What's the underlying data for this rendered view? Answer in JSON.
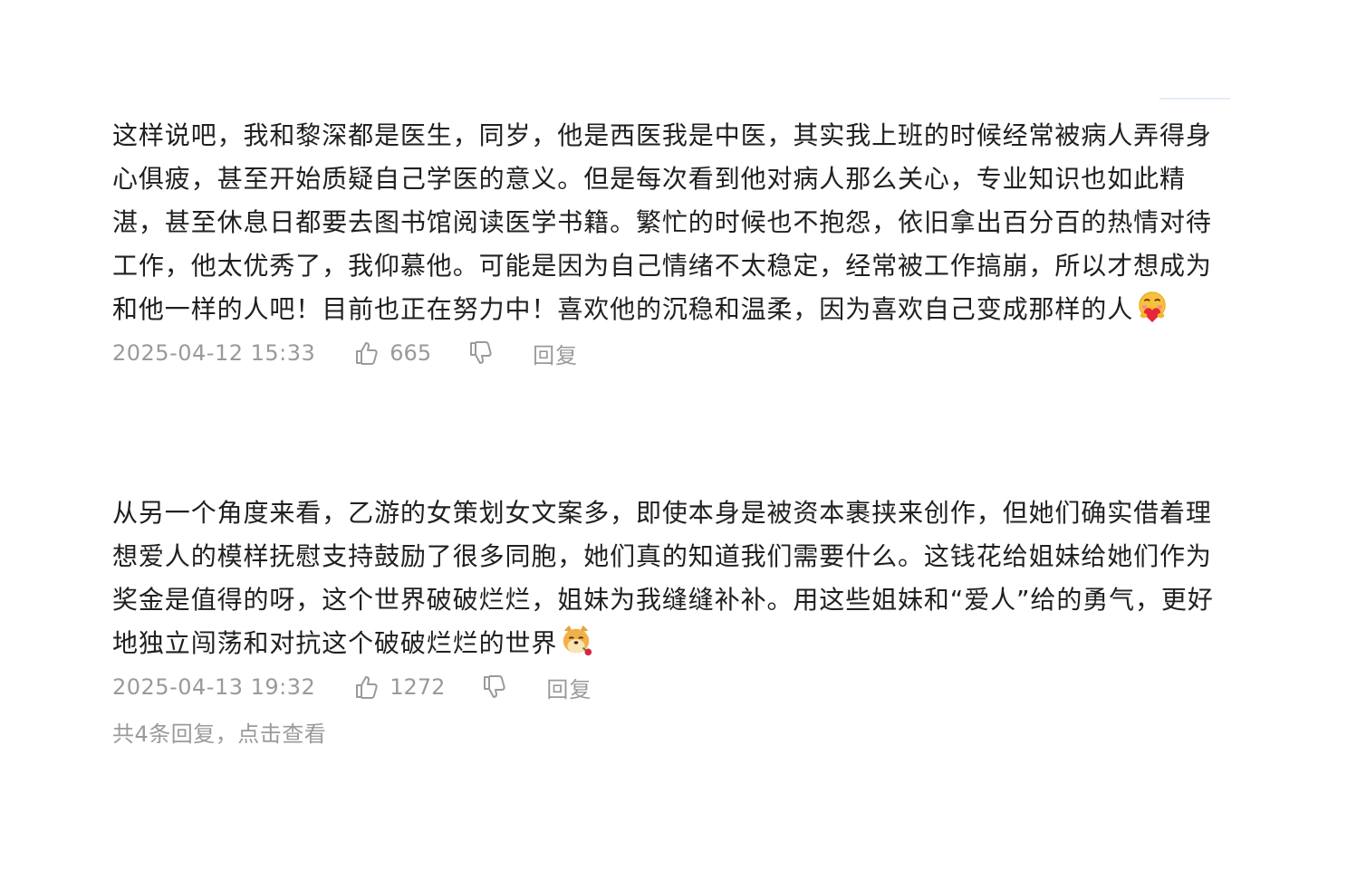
{
  "comments": [
    {
      "text": "这样说吧，我和黎深都是医生，同岁，他是西医我是中医，其实我上班的时候经常被病人弄得身心俱疲，甚至开始质疑自己学医的意义。但是每次看到他对病人那么关心，专业知识也如此精湛，甚至休息日都要去图书馆阅读医学书籍。繁忙的时候也不抱怨，依旧拿出百分百的热情对待工作，他太优秀了，我仰慕他。可能是因为自己情绪不太稳定，经常被工作搞崩，所以才想成为和他一样的人吧！目前也正在努力中！喜欢他的沉稳和温柔，因为喜欢自己变成那样的人",
      "emoji": "hugging-heart-emoji",
      "date": "2025-04-12 15:33",
      "likes": "665",
      "reply_label": "回复"
    },
    {
      "text": "从另一个角度来看，乙游的女策划女文案多，即使本身是被资本裹挟来创作，但她们确实借着理想爱人的模样抚慰支持鼓励了很多同胞，她们真的知道我们需要什么。这钱花给姐妹给她们作为奖金是值得的呀，这个世界破破烂烂，姐妹为我缝缝补补。用这些姐妹和“爱人”给的勇气，更好地独立闯荡和对抗这个破破烂烂的世界",
      "emoji": "doge-rose-emoji",
      "date": "2025-04-13 19:32",
      "likes": "1272",
      "reply_label": "回复",
      "replies_summary": "共4条回复，点击查看"
    }
  ],
  "colors": {
    "text": "#202020",
    "meta": "#9a9a9a",
    "background": "#ffffff"
  }
}
